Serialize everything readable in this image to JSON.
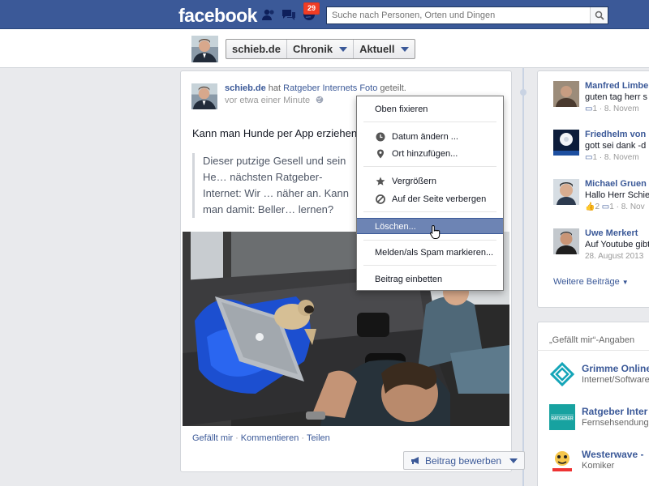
{
  "topbar": {
    "logo": "facebook",
    "notif_count": "29",
    "search_placeholder": "Suche nach Personen, Orten und Dingen"
  },
  "timeline_header": {
    "name": "schieb.de",
    "chronik": "Chronik",
    "aktuell": "Aktuell"
  },
  "post": {
    "author": "schieb.de",
    "verb1": " hat ",
    "shared_from": "Ratgeber Internets Foto",
    "verb2": " geteilt.",
    "time": "vor etwa einer Minute",
    "title": "Kann man Hunde per App erziehen?",
    "quote": "Dieser putzige Gesell und sein He… nächsten Ratgeber-Internet: Wir … näher an. Kann man damit: Beller… lernen?",
    "actions": {
      "like": "Gefällt mir",
      "comment": "Kommentieren",
      "share": "Teilen"
    },
    "promote": "Beitrag bewerben"
  },
  "menu": {
    "items": [
      {
        "label": "Oben fixieren",
        "icon": ""
      },
      {
        "label": "Datum ändern ...",
        "icon": "clock-icon"
      },
      {
        "label": "Ort hinzufügen...",
        "icon": "location-pin-icon"
      },
      {
        "label": "Vergrößern",
        "icon": "star-icon"
      },
      {
        "label": "Auf der Seite verbergen",
        "icon": "hide-icon"
      },
      {
        "label": "Löschen...",
        "icon": "",
        "highlighted": true
      },
      {
        "label": "Melden/als Spam markieren...",
        "icon": ""
      },
      {
        "label": "Beitrag einbetten",
        "icon": ""
      }
    ]
  },
  "recent_activity": [
    {
      "name": "Manfred Limbe",
      "text": "guten tag herr s",
      "meta_count": "1",
      "meta_date": "8. Novem"
    },
    {
      "name": "Friedhelm von",
      "text": "gott sei dank -d",
      "meta_count": "1",
      "meta_date": "8. Novem"
    },
    {
      "name": "Michael Gruen",
      "text": "Hallo Herr Schieb",
      "meta_likes": "2",
      "meta_count": "1",
      "meta_date": "8. Nov"
    },
    {
      "name": "Uwe Merkert",
      "text": "Auf Youtube gibt",
      "meta_date": "28. August 2013"
    }
  ],
  "more_posts": "Weitere Beiträge",
  "likes": {
    "title": "„Gefällt mir“-Angaben",
    "pages": [
      {
        "name": "Grimme Online",
        "category": "Internet/Software"
      },
      {
        "name": "Ratgeber Inter",
        "category": "Fernsehsendung"
      },
      {
        "name": "Westerwave -",
        "category": "Komiker"
      }
    ]
  },
  "colors": {
    "brand": "#3b5998",
    "badge": "#f03d25",
    "menu_highlight": "#6d84b4"
  }
}
